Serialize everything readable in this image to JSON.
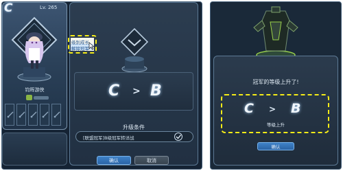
{
  "left_window": {
    "card": {
      "grade": "C",
      "level": "Lv. 265",
      "name": "钧晖游侠"
    },
    "tooltip": {
      "line1": "级别成长",
      "line2": "解除冠军"
    },
    "dialog": {
      "from_grade": "C",
      "arrow": ">",
      "to_grade": "B",
      "conditions_title": "升级条件",
      "condition_text": "[联盟冠军]B级冠军转详战",
      "confirm_label": "确认",
      "cancel_label": "取消"
    }
  },
  "right_window": {
    "title": "冠军的等级上升了!",
    "from_grade": "C",
    "arrow": ">",
    "to_grade": "B",
    "subtitle": "等级上升",
    "confirm_label": "确认"
  },
  "colors": {
    "highlight": "#f5ec17",
    "panel": "#213042",
    "button_blue": "#2a63a5"
  }
}
